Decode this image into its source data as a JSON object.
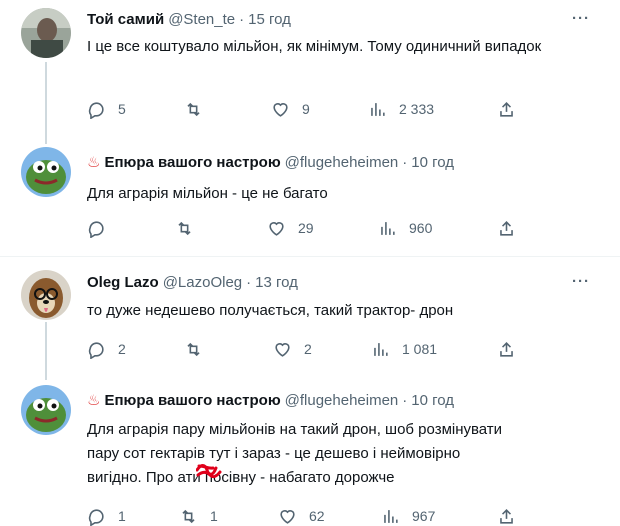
{
  "tweets": [
    {
      "name": "Той самий",
      "emoji": "",
      "handle": "@Sten_te",
      "time": "15 год",
      "text": "І це все коштувало мільйон, як мінімум. Тому одиничний випадок",
      "replies": "5",
      "retweets": "",
      "likes": "9",
      "views": "2 333"
    },
    {
      "name": "Епюра вашого настрою",
      "emoji": "♨",
      "handle": "@flugeheheimen",
      "time": "10 год",
      "text": "Для аграрія мільйон - це не багато",
      "replies": "",
      "retweets": "",
      "likes": "29",
      "views": "960"
    },
    {
      "name": "Oleg Lazo",
      "emoji": "",
      "handle": "@LazoOleg",
      "time": "13 год",
      "text": "то дуже недешево получається, такий трактор- дрон",
      "replies": "2",
      "retweets": "",
      "likes": "2",
      "views": "1 081"
    },
    {
      "name": "Епюра вашого настрою",
      "emoji": "♨",
      "handle": "@flugeheheimen",
      "time": "10 год",
      "text_line1": "Для аграрія пару мільйонів на такий дрон, шоб розмінувати",
      "text_line2": "пару сот гектарів тут і зараз - це дешево і неймовірно",
      "text_line3": "вигідно. Про  ати посівну - набагато дорожче",
      "replies": "1",
      "retweets": "1",
      "likes": "62",
      "views": "967"
    }
  ],
  "separator": "·",
  "more_icon": "···",
  "colors": {
    "text": "#0f1419",
    "muted": "#536471",
    "line": "#cfd9de",
    "divider": "#eff3f4",
    "emoji": "#e03a3a",
    "redaction": "#e0001b"
  }
}
